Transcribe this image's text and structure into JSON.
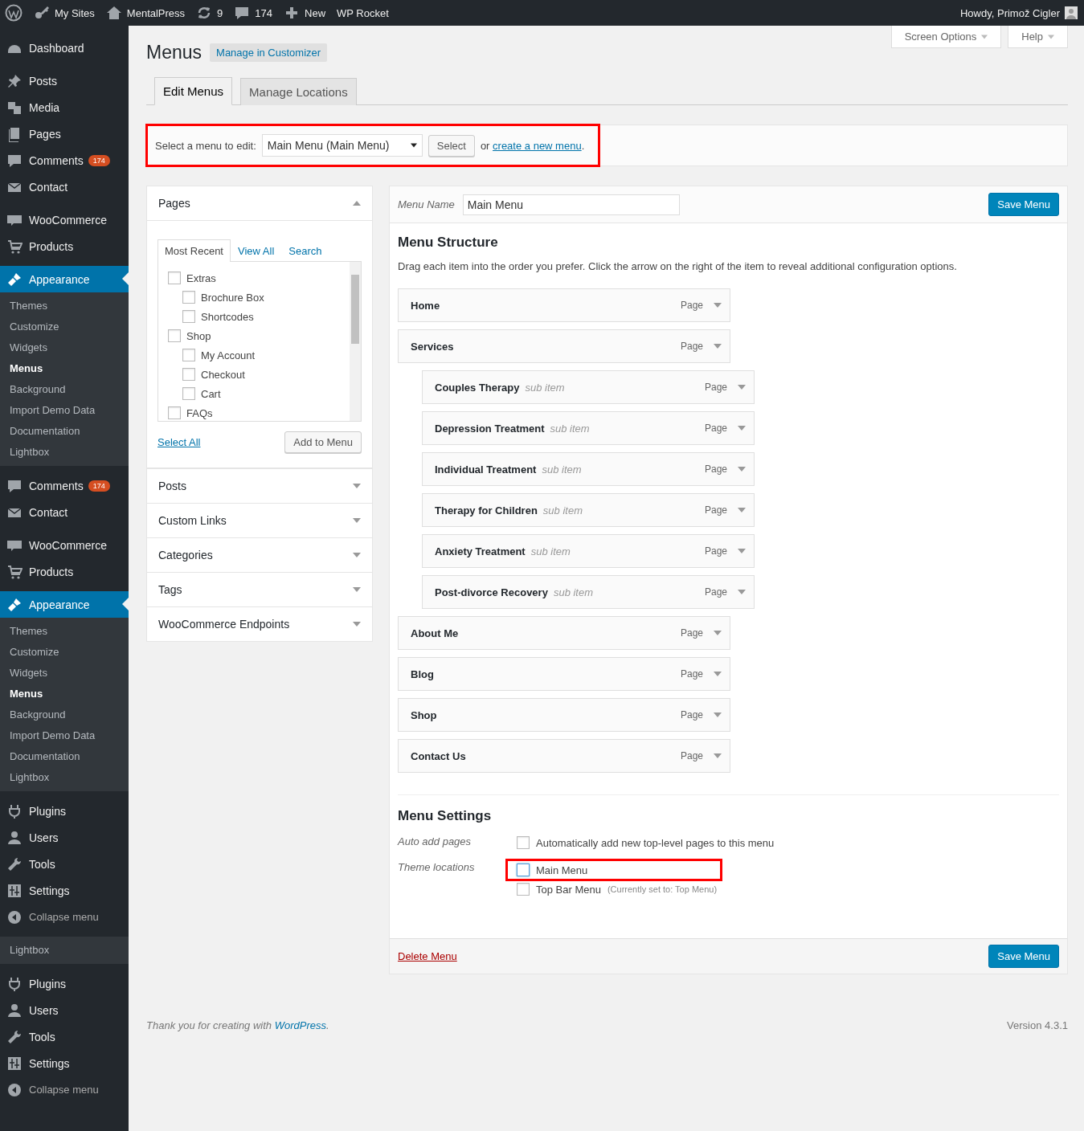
{
  "admin_bar": {
    "items": [
      {
        "label": "My Sites"
      },
      {
        "label": "MentalPress"
      },
      {
        "label": "9"
      },
      {
        "label": "174"
      },
      {
        "label": "New"
      },
      {
        "label": "WP Rocket"
      }
    ],
    "greeting": "Howdy, Primož Cigler"
  },
  "sidebar": {
    "sections": [
      [
        {
          "label": "Dashboard",
          "kind": "menu",
          "selected": false
        }
      ],
      [
        {
          "label": "Posts",
          "kind": "menu",
          "selected": false
        },
        {
          "label": "Media",
          "kind": "menu",
          "selected": false
        },
        {
          "label": "Pages",
          "kind": "menu",
          "selected": false
        },
        {
          "label": "Comments",
          "badge": "174",
          "kind": "menu",
          "selected": false
        },
        {
          "label": "Contact",
          "kind": "menu",
          "selected": false
        }
      ],
      [
        {
          "label": "WooCommerce",
          "kind": "menu",
          "selected": false
        },
        {
          "label": "Products",
          "kind": "menu",
          "selected": false
        }
      ],
      [
        {
          "label": "Appearance",
          "kind": "menu",
          "selected": true,
          "children": [
            {
              "label": "Themes",
              "selected": false
            },
            {
              "label": "Customize",
              "selected": false
            },
            {
              "label": "Widgets",
              "selected": false
            },
            {
              "label": "Menus",
              "selected": true
            },
            {
              "label": "Background",
              "selected": false
            },
            {
              "label": "Import Demo Data",
              "selected": false
            },
            {
              "label": "Documentation",
              "selected": false
            },
            {
              "label": "Lightbox",
              "selected": false
            }
          ]
        }
      ],
      [
        {
          "label": "Comments",
          "badge": "174",
          "kind": "menu",
          "selected": false
        },
        {
          "label": "Contact",
          "kind": "menu",
          "selected": false
        }
      ],
      [
        {
          "label": "WooCommerce",
          "kind": "menu",
          "selected": false
        },
        {
          "label": "Products",
          "kind": "menu",
          "selected": false
        }
      ],
      [
        {
          "label": "Appearance",
          "kind": "menu",
          "selected": true,
          "children": [
            {
              "label": "Themes",
              "selected": false
            },
            {
              "label": "Customize",
              "selected": false
            },
            {
              "label": "Widgets",
              "selected": false
            },
            {
              "label": "Menus",
              "selected": true
            },
            {
              "label": "Background",
              "selected": false
            },
            {
              "label": "Import Demo Data",
              "selected": false
            },
            {
              "label": "Documentation",
              "selected": false
            },
            {
              "label": "Lightbox",
              "selected": false
            }
          ]
        }
      ],
      [
        {
          "label": "Plugins",
          "kind": "menu",
          "selected": false
        },
        {
          "label": "Users",
          "kind": "menu",
          "selected": false
        },
        {
          "label": "Tools",
          "kind": "menu",
          "selected": false
        },
        {
          "label": "Settings",
          "kind": "menu",
          "selected": false
        },
        {
          "label": "Collapse menu",
          "kind": "collapse",
          "selected": false
        }
      ],
      [
        {
          "label": "Lightbox",
          "kind": "submenu",
          "selected": false
        }
      ],
      [
        {
          "label": "Plugins",
          "kind": "menu",
          "selected": false
        },
        {
          "label": "Users",
          "kind": "menu",
          "selected": false
        },
        {
          "label": "Tools",
          "kind": "menu",
          "selected": false
        },
        {
          "label": "Settings",
          "kind": "menu",
          "selected": false
        },
        {
          "label": "Collapse menu",
          "kind": "collapse",
          "selected": false
        }
      ]
    ]
  },
  "screen_meta": [
    {
      "label": "Screen Options"
    },
    {
      "label": "Help"
    }
  ],
  "page": {
    "title": "Menus",
    "customizer_link": "Manage in Customizer"
  },
  "tabs": [
    {
      "label": "Edit Menus",
      "selected": true
    },
    {
      "label": "Manage Locations",
      "selected": false
    }
  ],
  "menu_select": {
    "label": "Select a menu to edit:",
    "value": "Main Menu (Main Menu)",
    "button": "Select",
    "or": "or",
    "link": "create a new menu",
    "after": ".",
    "highlighted": true
  },
  "panels": [
    {
      "title": "Pages",
      "expanded": true,
      "tabs": [
        {
          "label": "Most Recent",
          "selected": true
        },
        {
          "label": "View All",
          "selected": false
        },
        {
          "label": "Search",
          "selected": false
        }
      ],
      "items": [
        {
          "label": "Extras",
          "checked": false,
          "children": [
            {
              "label": "Brochure Box",
              "checked": false
            },
            {
              "label": "Shortcodes",
              "checked": false
            }
          ]
        },
        {
          "label": "Shop",
          "checked": false,
          "children": [
            {
              "label": "My Account",
              "checked": false
            },
            {
              "label": "Checkout",
              "checked": false
            },
            {
              "label": "Cart",
              "checked": false
            }
          ]
        },
        {
          "label": "FAQs",
          "checked": false
        }
      ],
      "select_all": "Select All",
      "add_button": "Add to Menu"
    },
    {
      "title": "Posts",
      "expanded": false
    },
    {
      "title": "Custom Links",
      "expanded": false
    },
    {
      "title": "Categories",
      "expanded": false
    },
    {
      "title": "Tags",
      "expanded": false
    },
    {
      "title": "WooCommerce Endpoints",
      "expanded": false
    }
  ],
  "editor": {
    "name_label": "Menu Name",
    "name": "Main Menu",
    "save": "Save Menu",
    "structure_title": "Menu Structure",
    "hint": "Drag each item into the order you prefer. Click the arrow on the right of the item to reveal additional configuration options.",
    "items": [
      {
        "title": "Home",
        "type": "Page"
      },
      {
        "title": "Services",
        "type": "Page",
        "children": [
          {
            "title": "Couples Therapy",
            "note": "sub item",
            "type": "Page"
          },
          {
            "title": "Depression Treatment",
            "note": "sub item",
            "type": "Page"
          },
          {
            "title": "Individual Treatment",
            "note": "sub item",
            "type": "Page"
          },
          {
            "title": "Therapy for Children",
            "note": "sub item",
            "type": "Page"
          },
          {
            "title": "Anxiety Treatment",
            "note": "sub item",
            "type": "Page"
          },
          {
            "title": "Post-divorce Recovery",
            "note": "sub item",
            "type": "Page"
          }
        ]
      },
      {
        "title": "About Me",
        "type": "Page"
      },
      {
        "title": "Blog",
        "type": "Page"
      },
      {
        "title": "Shop",
        "type": "Page"
      },
      {
        "title": "Contact Us",
        "type": "Page"
      }
    ],
    "settings_title": "Menu Settings",
    "settings": [
      {
        "label": "Auto add pages",
        "options": [
          {
            "label": "Automatically add new top-level pages to this menu",
            "checked": false,
            "highlighted": false
          }
        ]
      },
      {
        "label": "Theme locations",
        "options": [
          {
            "label": "Main Menu",
            "checked": false,
            "highlighted": true
          },
          {
            "label": "Top Bar Menu",
            "note": "(Currently set to: Top Menu)",
            "checked": false,
            "highlighted": false
          }
        ]
      }
    ],
    "delete": "Delete Menu",
    "save_bottom": "Save Menu"
  },
  "footer": {
    "before": "Thank you for creating with",
    "link": "WordPress",
    "after": ".",
    "version": "Version 4.3.1"
  }
}
